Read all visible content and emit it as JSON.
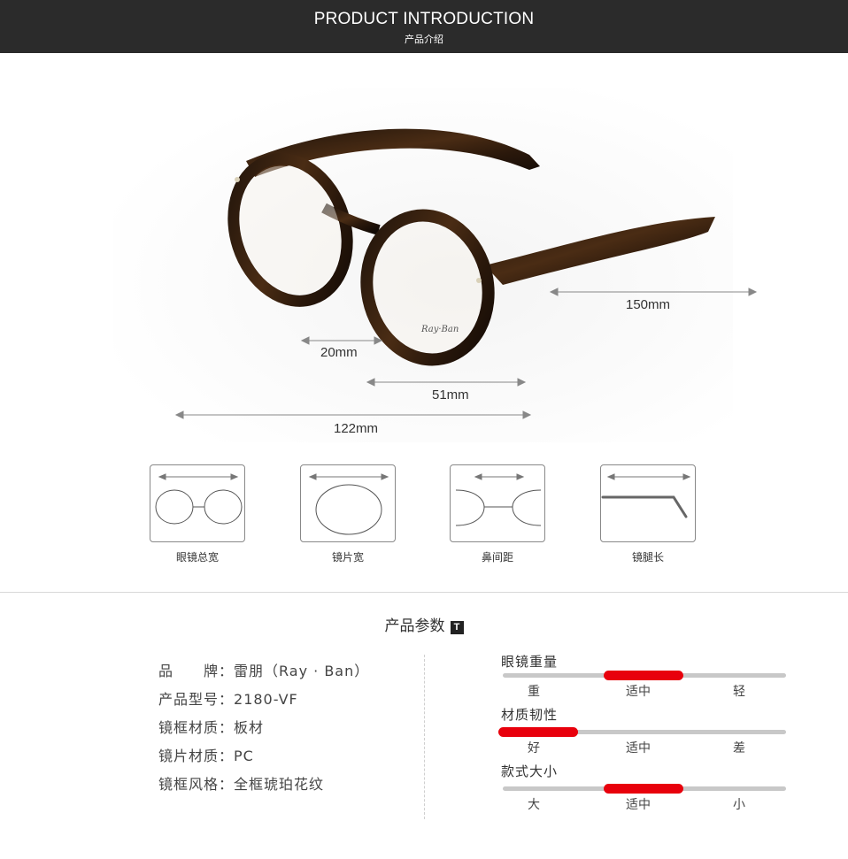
{
  "header": {
    "title": "PRODUCT INTRODUCTION",
    "subtitle": "产品介绍"
  },
  "dimensions": {
    "temple": "150mm",
    "bridge": "20mm",
    "lens": "51mm",
    "total": "122mm"
  },
  "icons": [
    {
      "label": "眼镜总宽",
      "icon": "total-width-icon"
    },
    {
      "label": "镜片宽",
      "icon": "lens-width-icon"
    },
    {
      "label": "鼻间距",
      "icon": "bridge-width-icon"
    },
    {
      "label": "镜腿长",
      "icon": "temple-length-icon"
    }
  ],
  "params": {
    "title": "产品参数",
    "title_badge": "T",
    "specs": [
      {
        "label": "品　　牌：",
        "value": "雷朋（Ray · Ban）"
      },
      {
        "label": "产品型号：",
        "value": "2180-VF"
      },
      {
        "label": "镜框材质：",
        "value": "板材"
      },
      {
        "label": "镜片材质：",
        "value": "PC"
      },
      {
        "label": "镜框风格：",
        "value": "全框琥珀花纹"
      }
    ],
    "meters": [
      {
        "title": "眼镜重量",
        "labels": [
          "重",
          "适中",
          "轻"
        ],
        "level": 0.5
      },
      {
        "title": "材质韧性",
        "labels": [
          "好",
          "适中",
          "差"
        ],
        "level": 0.0
      },
      {
        "title": "款式大小",
        "labels": [
          "大",
          "适中",
          "小"
        ],
        "level": 0.5
      }
    ]
  },
  "colors": {
    "header_bg": "#2b2b2b",
    "accent_red": "#e8000c",
    "frame_tortoise": "#2a1a0e"
  }
}
